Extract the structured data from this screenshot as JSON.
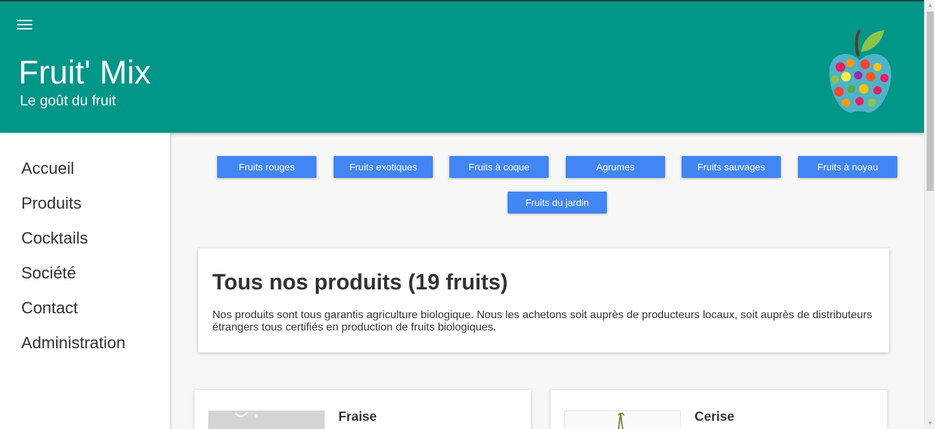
{
  "header": {
    "title": "Fruit' Mix",
    "subtitle": "Le goût du fruit",
    "menu_icon": "hamburger-menu-icon",
    "logo": "colorful-apple-logo"
  },
  "sidebar": {
    "items": [
      {
        "label": "Accueil"
      },
      {
        "label": "Produits"
      },
      {
        "label": "Cocktails"
      },
      {
        "label": "Société"
      },
      {
        "label": "Contact"
      },
      {
        "label": "Administration"
      }
    ]
  },
  "categories": [
    {
      "label": "Fruits rouges"
    },
    {
      "label": "Fruits exotiques"
    },
    {
      "label": "Fruits à coque"
    },
    {
      "label": "Agrumes"
    },
    {
      "label": "Fruits sauvages"
    },
    {
      "label": "Fruits à noyau"
    },
    {
      "label": "Fruits du jardin"
    }
  ],
  "intro": {
    "title": "Tous nos produits (19 fruits)",
    "text": "Nos produits sont tous garantis agriculture biologique. Nous les achetons soit auprès de producteurs locaux, soit auprès de distributeurs étrangers tous certifiés en production de fruits biologiques."
  },
  "products": [
    {
      "name": "Fraise"
    },
    {
      "name": "Cerise"
    }
  ],
  "colors": {
    "header_bg": "#009688",
    "button_bg": "#4285f4",
    "page_bg": "#f7f7f7"
  }
}
